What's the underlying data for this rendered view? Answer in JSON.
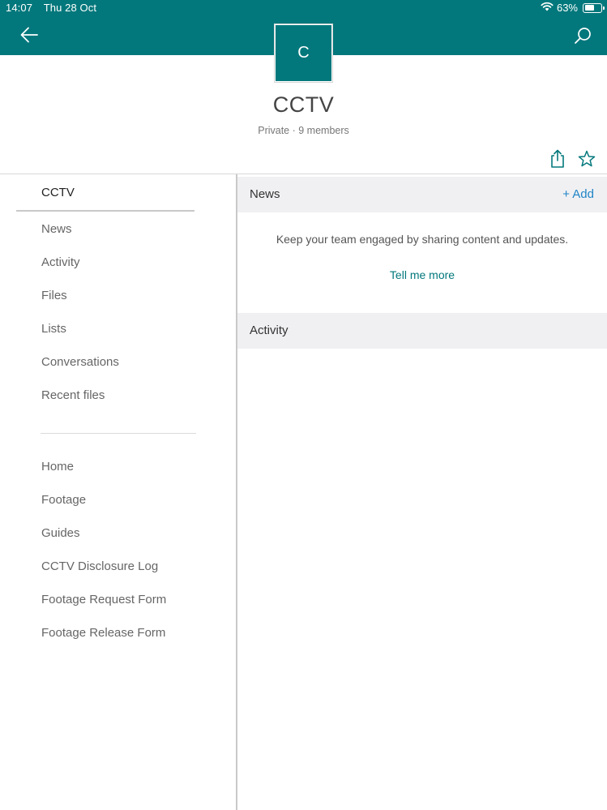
{
  "status": {
    "time": "14:07",
    "date": "Thu 28 Oct",
    "battery": "63%",
    "battery_level": 0.63
  },
  "icons": {
    "back": "back-arrow-icon",
    "search": "search-icon",
    "share": "share-icon",
    "favorite": "star-icon",
    "wifi": "wifi-icon",
    "battery": "battery-icon"
  },
  "colors": {
    "brand": "#03787c",
    "link": "#1f84c7"
  },
  "site": {
    "logo_letter": "C",
    "title": "CCTV",
    "meta": "Private · 9 members"
  },
  "nav": {
    "current": "CCTV",
    "primary": [
      "News",
      "Activity",
      "Files",
      "Lists",
      "Conversations",
      "Recent files"
    ],
    "links": [
      "Home",
      "Footage",
      "Guides",
      "CCTV Disclosure Log",
      "Footage Request Form",
      "Footage Release Form"
    ]
  },
  "news": {
    "label": "News",
    "add_label": "+ Add",
    "empty_text": "Keep your team engaged by sharing content and updates.",
    "tell_more": "Tell me more"
  },
  "activity": {
    "label": "Activity"
  }
}
